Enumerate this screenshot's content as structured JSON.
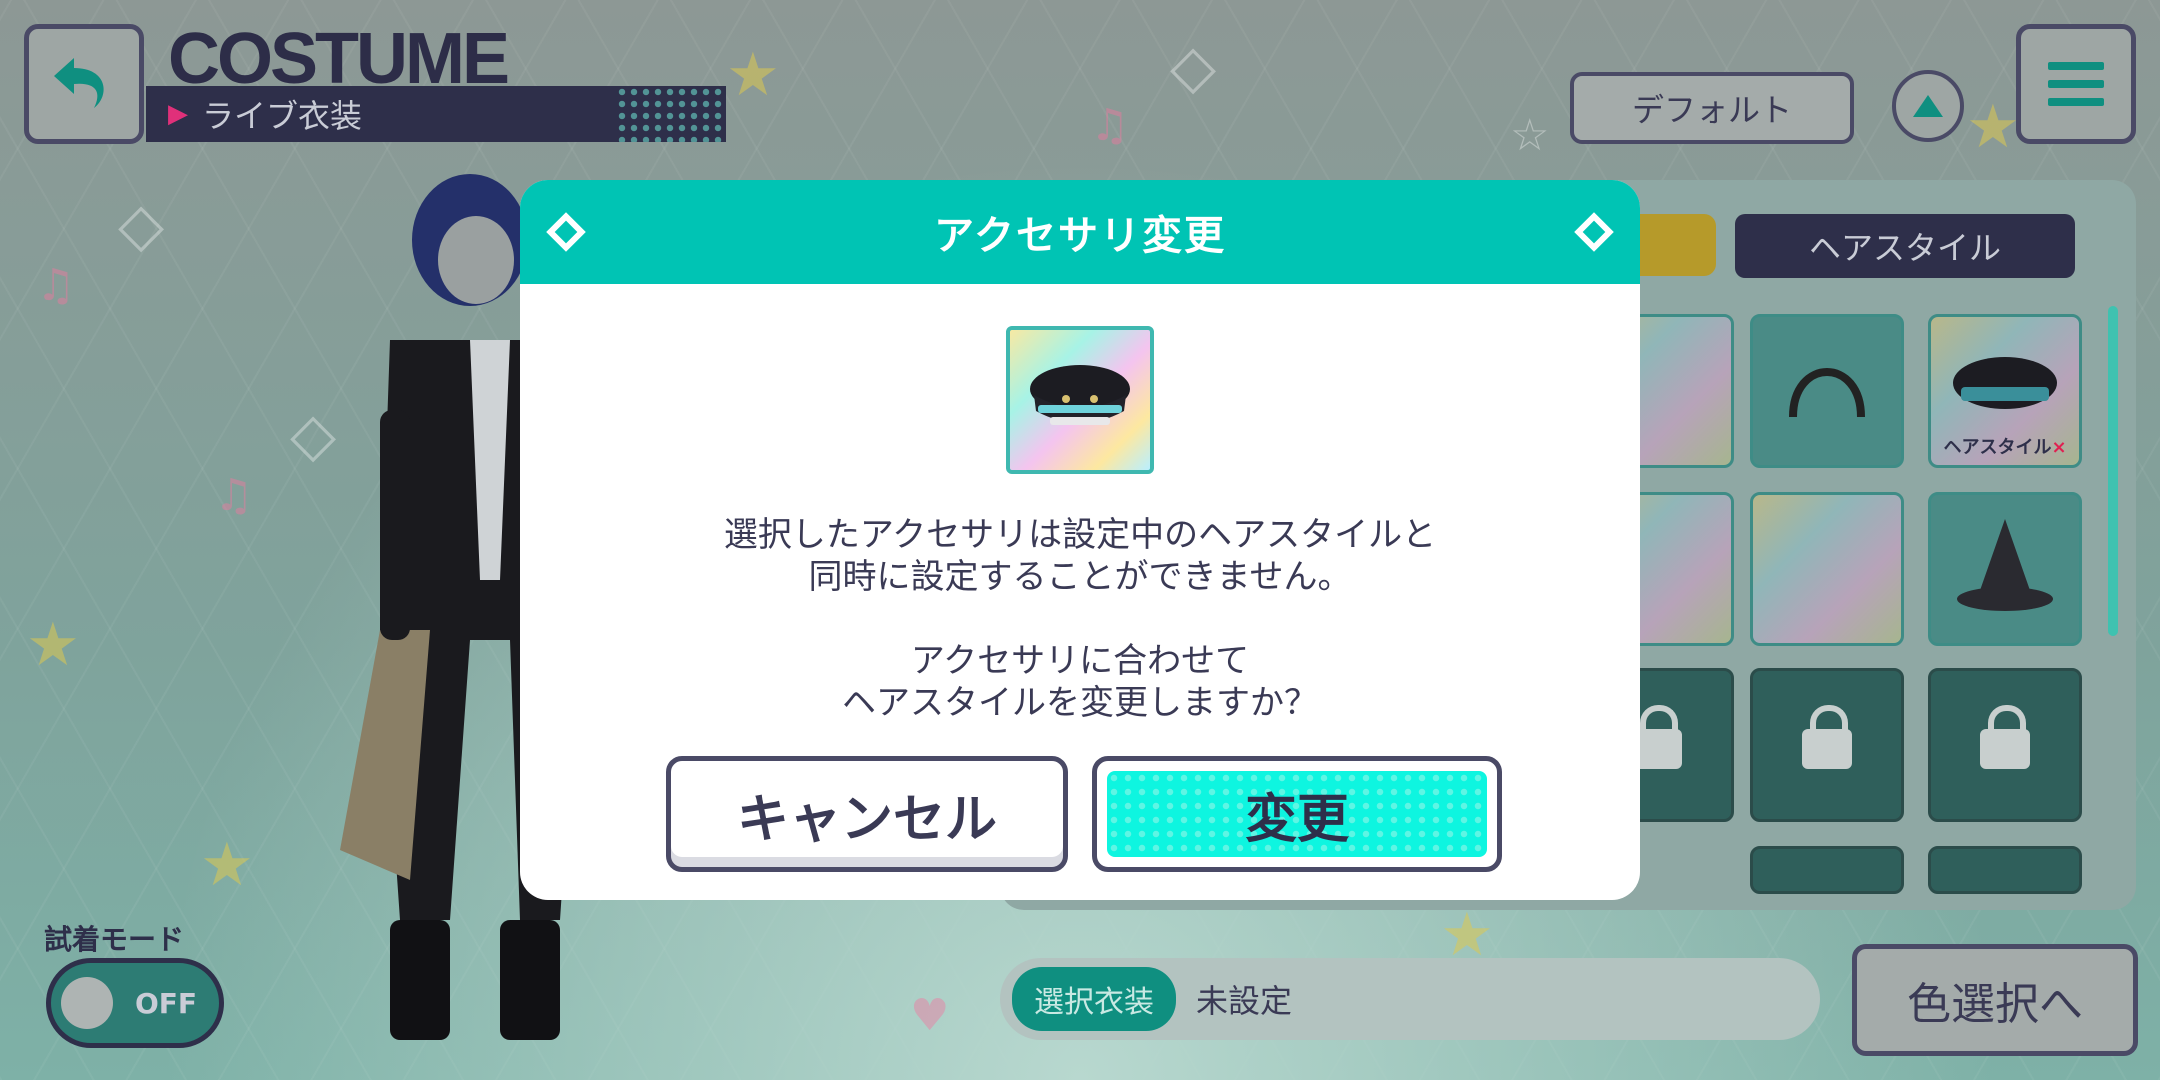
{
  "header": {
    "title": "COSTUME",
    "subtitle": "ライブ衣装",
    "default_label": "デフォルト"
  },
  "tabs": {
    "hairstyle_label": "ヘアスタイル"
  },
  "grid": {
    "ng_badge_text": "ヘアスタイル",
    "ng_badge_mark": "×"
  },
  "bottom": {
    "tryon_label": "試着モード",
    "tryon_state": "OFF",
    "selected_label": "選択衣装",
    "selected_value": "未設定",
    "color_select_label": "色選択へ"
  },
  "dialog": {
    "title": "アクセサリ変更",
    "message_line1": "選択したアクセサリは設定中のヘアスタイルと",
    "message_line2": "同時に設定することができません。",
    "question_line1": "アクセサリに合わせて",
    "question_line2": "ヘアスタイルを変更しますか？",
    "cancel_label": "キャンセル",
    "confirm_label": "変更"
  },
  "colors": {
    "accent": "#00c4b4",
    "confirm_fill": "#0ef5e0",
    "frame": "#4a4a66"
  }
}
